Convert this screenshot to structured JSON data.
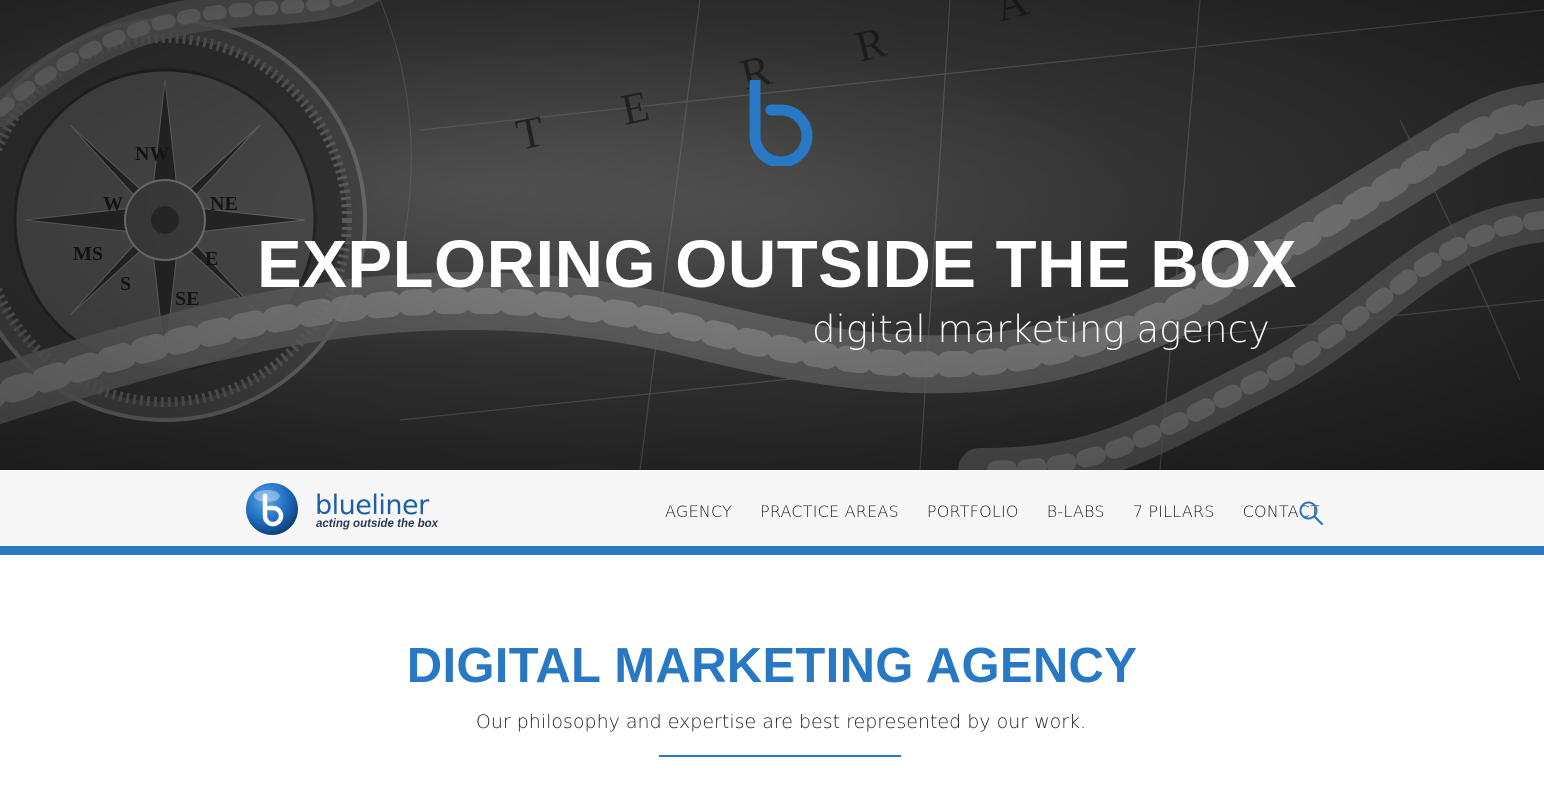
{
  "hero": {
    "title": "EXPLORING OUTSIDE THE BOX",
    "subtitle": "digital marketing agency",
    "logo_icon": "blueliner-b-logo",
    "background": "compass-map-rope-photo"
  },
  "navbar": {
    "brand_name": "blueliner",
    "brand_tagline": "acting outside the box",
    "items": [
      {
        "label": "AGENCY"
      },
      {
        "label": "PRACTICE AREAS"
      },
      {
        "label": "PORTFOLIO"
      },
      {
        "label": "B-LABS"
      },
      {
        "label": "7 PILLARS"
      },
      {
        "label": "CONTACT"
      }
    ],
    "search_icon": "search-icon"
  },
  "intro": {
    "title": "DIGITAL MARKETING AGENCY",
    "text": "Our philosophy and expertise are best represented by our work."
  },
  "colors": {
    "brand_blue": "#2878c3",
    "navbar_bg": "#f7f7f7",
    "hero_overlay": "#3c3c3c"
  }
}
